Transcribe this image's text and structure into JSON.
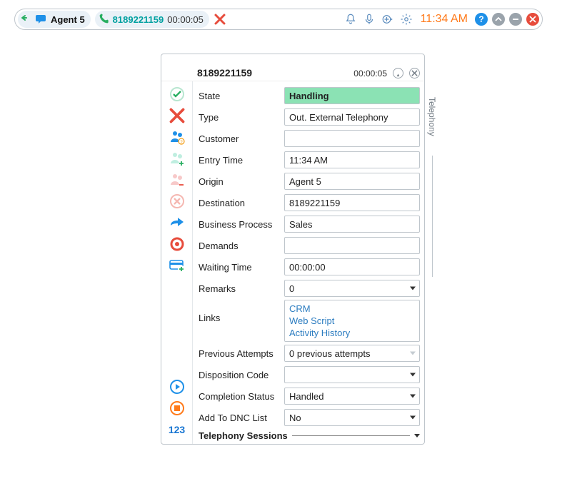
{
  "topbar": {
    "agent_label": "Agent 5",
    "call_number": "8189221159",
    "call_timer": "00:00:05",
    "clock": "11:34 AM"
  },
  "panel": {
    "title": "8189221159",
    "timer": "00:00:05",
    "side_tab": "Telephony",
    "fields": {
      "state_label": "State",
      "state_value": "Handling",
      "type_label": "Type",
      "type_value": "Out. External Telephony",
      "customer_label": "Customer",
      "customer_value": "",
      "entry_label": "Entry Time",
      "entry_value": "11:34 AM",
      "origin_label": "Origin",
      "origin_value": "Agent 5",
      "destination_label": "Destination",
      "destination_value": "8189221159",
      "bp_label": "Business Process",
      "bp_value": "Sales",
      "demands_label": "Demands",
      "demands_value": "",
      "wait_label": "Waiting Time",
      "wait_value": "00:00:00",
      "remarks_label": "Remarks",
      "remarks_value": "0",
      "links_label": "Links",
      "link_crm": "CRM",
      "link_script": "Web Script",
      "link_history": "Activity History",
      "attempts_label": "Previous Attempts",
      "attempts_value": "0 previous attempts",
      "dispo_label": "Disposition Code",
      "dispo_value": "",
      "completion_label": "Completion Status",
      "completion_value": "Handled",
      "dnc_label": "Add To DNC List",
      "dnc_value": "No",
      "sessions_label": "Telephony Sessions"
    },
    "rail_123": "123"
  }
}
